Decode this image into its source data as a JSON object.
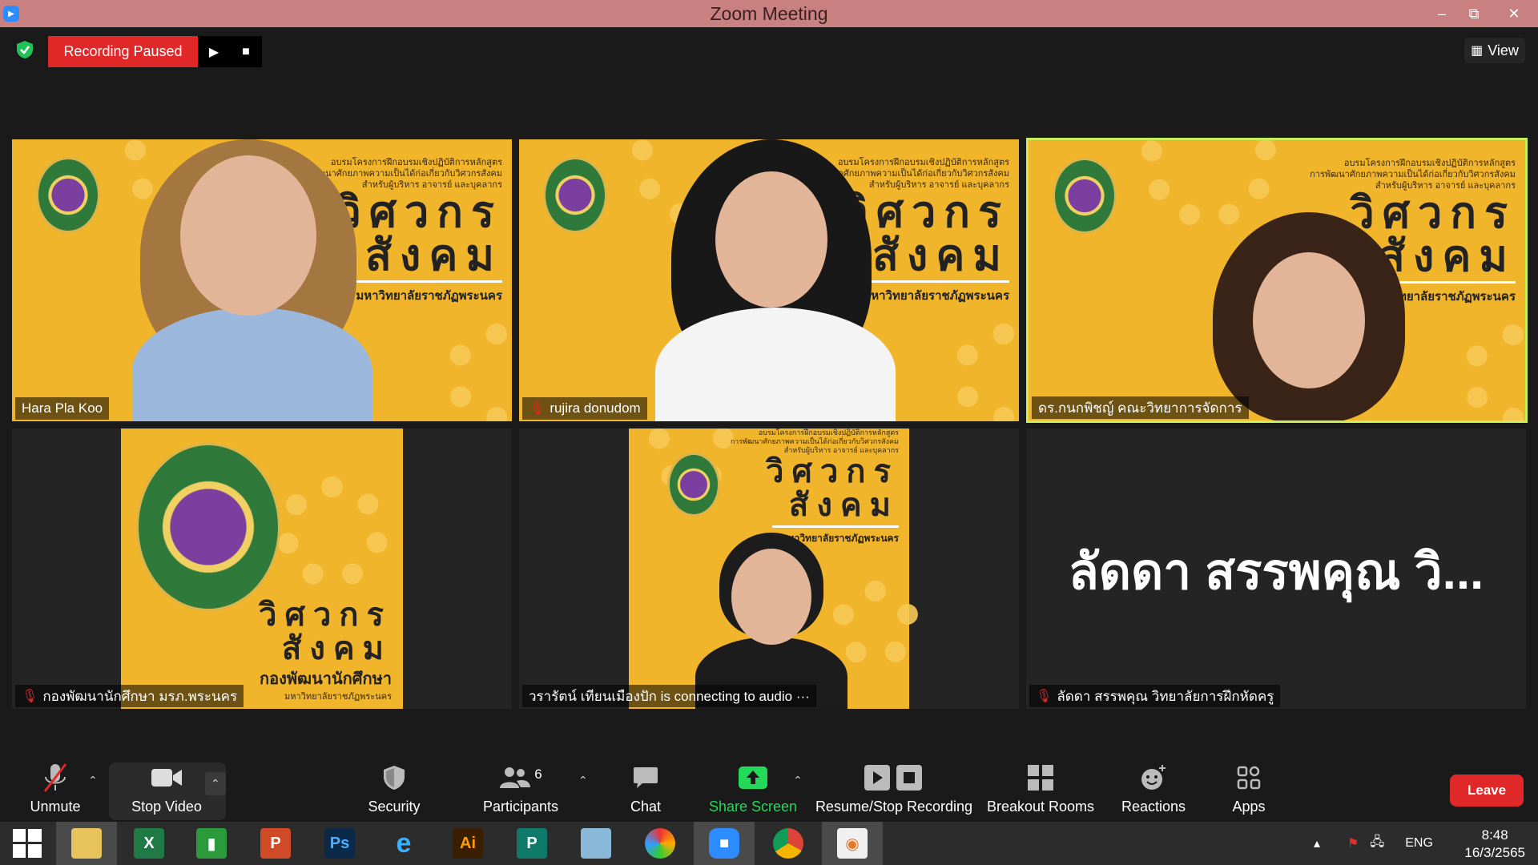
{
  "window": {
    "title": "Zoom Meeting",
    "app_icon": "zoom-icon"
  },
  "topbar": {
    "recording_status": "Recording Paused",
    "view_label": "View"
  },
  "tiles": [
    {
      "name": "Hara Pla Koo",
      "muted": false
    },
    {
      "name": "rujira donudom",
      "muted": true
    },
    {
      "name": "ดร.กนกพิชญ์ คณะวิทยาการจัดการ",
      "muted": false,
      "active_speaker": true
    },
    {
      "name": "กองพัฒนานักศึกษา มรภ.พระนคร",
      "muted": true
    },
    {
      "name": "วรารัตน์ เทียนเมืองปัก is connecting to audio ···",
      "muted": false
    },
    {
      "name": "ลัดดา สรรพคุณ วิทยาลัยการฝึกหัดครู",
      "muted": true,
      "display_name": "ลัดดา สรรพคุณ วิ..."
    }
  ],
  "banner": {
    "small_text": [
      "อบรมโครงการฝึกอบรมเชิงปฏิบัติการหลักสูตร",
      "การพัฒนาศักยภาพความเป็นได้ก่อเกี่ยวกับวิศวกรสังคม",
      "สำหรับผู้บริหาร อาจารย์ และบุคลากร"
    ],
    "title_line1": "วิศวกร",
    "title_line2": "สังคม",
    "university": "มหาวิทยาลัยราชภัฏพระนคร",
    "dept": "กองพัฒนานักศึกษา"
  },
  "toolbar": {
    "unmute": "Unmute",
    "stop_video": "Stop Video",
    "security": "Security",
    "participants": "Participants",
    "participants_count": "6",
    "chat": "Chat",
    "share_screen": "Share Screen",
    "recording": "Resume/Stop Recording",
    "breakout": "Breakout Rooms",
    "reactions": "Reactions",
    "apps": "Apps",
    "leave": "Leave"
  },
  "taskbar": {
    "lang": "ENG",
    "time": "8:48",
    "date": "16/3/2565"
  },
  "colors": {
    "accent_red": "#e02828",
    "share_green": "#23d959",
    "banner_yellow": "#f1b52c",
    "titlebar": "#c98080"
  }
}
